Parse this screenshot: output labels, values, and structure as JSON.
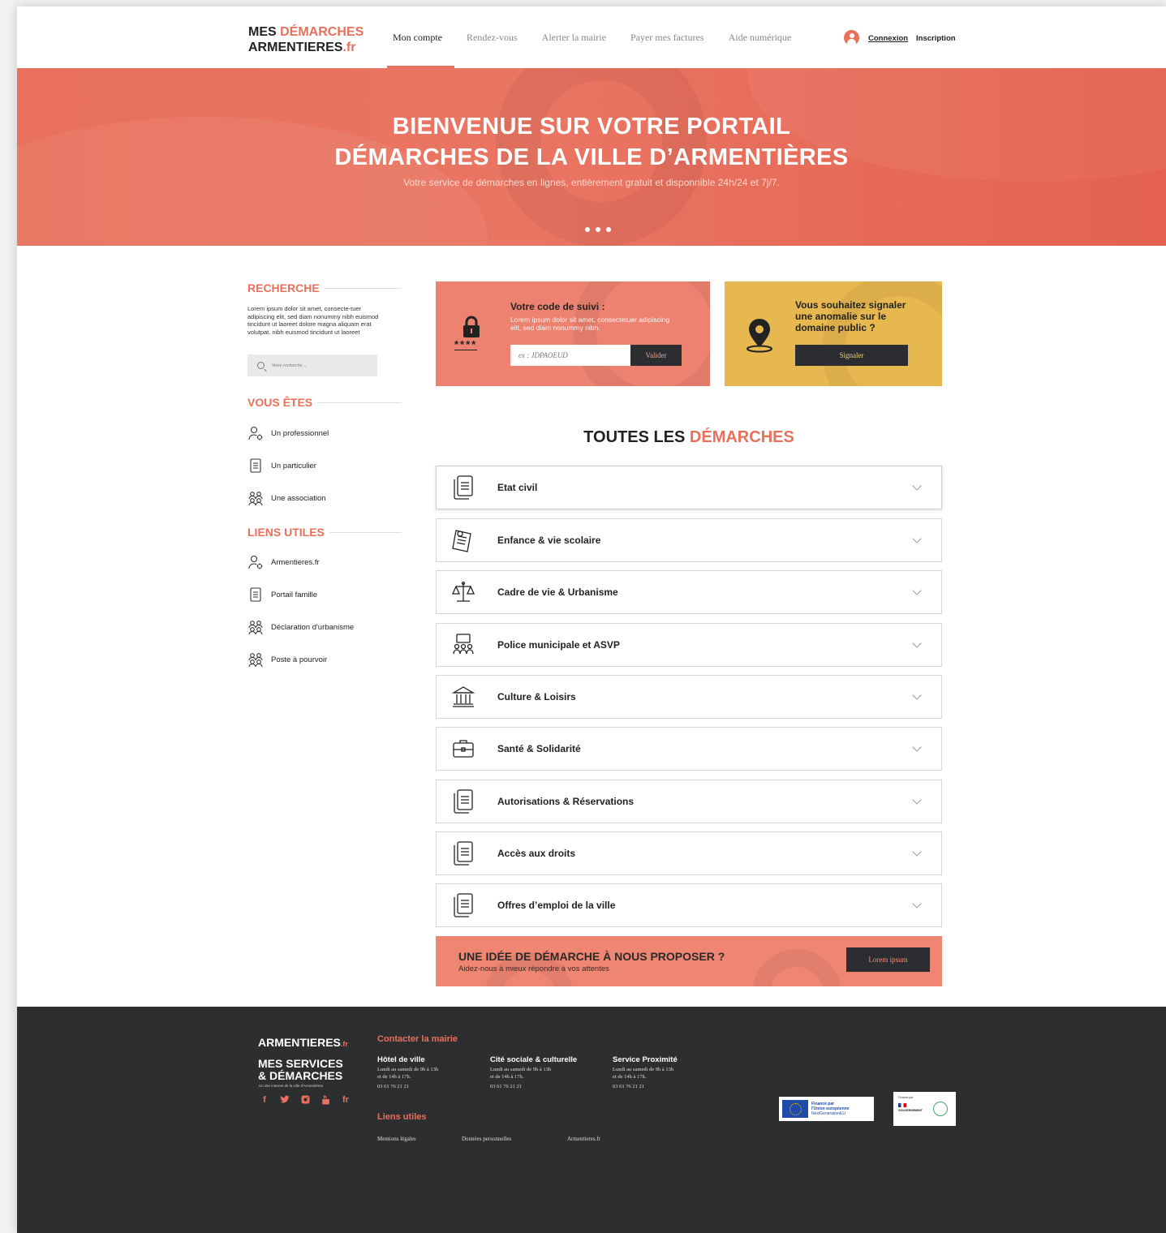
{
  "header": {
    "logo_line1_a": "MES ",
    "logo_line1_b": "DÉMARCHES",
    "logo_line2_a": "ARMENTIERES",
    "logo_line2_b": ".fr",
    "nav": [
      "Mon compte",
      "Rendez-vous",
      "Alerter la mairie",
      "Payer mes factures",
      "Aide numérique"
    ],
    "active_nav": "Mon compte",
    "login": "Connexion",
    "signup": "Inscription"
  },
  "hero": {
    "title_line1": "BIENVENUE SUR VOTRE PORTAIL",
    "title_line2": "DÉMARCHES DE LA VILLE D’ARMENTIÈRES",
    "subtitle": "Votre service de démarches en lignes, entièrement gratuit et disponnible 24h/24 et 7j/7."
  },
  "sidebar": {
    "search_title": "RECHERCHE",
    "search_text": "Lorem ipsum dolor sit amet, consecte-tuer adipiscing elit, sed diam nonummy nibh euismod tincidunt ut laoreet dolore magna aliquam erat volutpat. nibh euismod tincidunt ut laoreet",
    "search_placeholder": "Votre recherche ...",
    "vous_etes_title": "VOUS ÊTES",
    "vous_etes": [
      "Un professionnel",
      "Un particulier",
      "Une association"
    ],
    "liens_title": "LIENS UTILES",
    "liens": [
      "Armentieres.fr",
      "Portail famille",
      "Déclaration d'urbanisme",
      "Poste à pourvoir"
    ]
  },
  "code_card": {
    "title": "Votre code de suivi :",
    "text": "Lorem ipsum dolor sit amet, consectetuer adipiscing elit, sed diam nonummy nibh.",
    "stars": "****",
    "placeholder": "ex : JDPAOEUD",
    "button": "Valider"
  },
  "alert_card": {
    "title": "Vous souhaitez signaler une anomalie sur le domaine public ?",
    "button": "Signaler"
  },
  "demarches": {
    "title_a": "TOUTES LES ",
    "title_b": "DÉMARCHES",
    "items": [
      "Etat civil",
      "Enfance & vie scolaire",
      "Cadre de vie & Urbanisme",
      "Police municipale et ASVP",
      "Culture & Loisirs",
      "Santé & Solidarité",
      "Autorisations & Réservations",
      "Accès aux droits",
      "Offres d’emploi de la ville"
    ]
  },
  "idea": {
    "title": "UNE IDÉE DE DÉMARCHE À NOUS PROPOSER ?",
    "subtitle": "Aidez-nous à mieux répondre à vos attentes",
    "button": "Lorem ipsum"
  },
  "footer": {
    "logo1": "ARMENTIERES",
    "logo1_suffix": ".fr",
    "logo2_line1": "MES SERVICES",
    "logo2_line2": "& DÉMARCHES",
    "logo2_small": "Un site internet de la ville d'Armentières",
    "contact_title": "Contacter la mairie",
    "contacts": [
      {
        "name": "Hôtel de ville",
        "hours1": "Lundi au samedi de 9h à 13h",
        "hours2": "et de 14h à 17h.",
        "phone": "03 61 76 21 21"
      },
      {
        "name": "Cité sociale & culturelle",
        "hours1": "Lundi au samedi de 9h à 13h",
        "hours2": "et de 14h à 17h.",
        "phone": "03 61 76 21 21"
      },
      {
        "name": "Service Proximité",
        "hours1": "Lundi au samedi de 9h à 13h",
        "hours2": "et de 14h à 17h.",
        "phone": "03 61 76 21 21"
      }
    ],
    "links_title": "Liens utiles",
    "links": [
      "Mentions légales",
      "Données personnelles",
      "Armentieres.fr"
    ],
    "socials": [
      "f",
      "t",
      "i",
      "y",
      "fr"
    ],
    "eu_badge": [
      "Financé par",
      "l'Union européenne",
      "NextGenerationEU"
    ],
    "gov_badge_top": "Financé par",
    "gov_badge_name": "GOUVERNEMENT"
  },
  "colors": {
    "accent": "#e8705c",
    "yellow": "#e7b850",
    "dark": "#2d2e30"
  }
}
